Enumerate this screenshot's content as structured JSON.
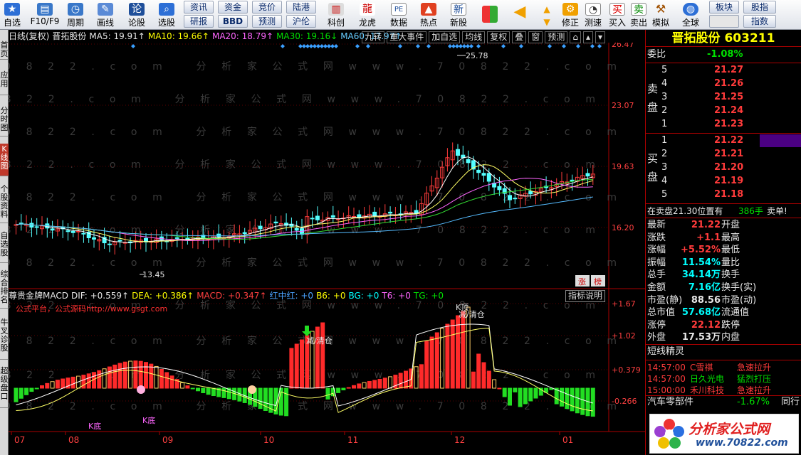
{
  "toolbar": {
    "buttons": [
      {
        "label": "自选"
      },
      {
        "label": "F10/F9"
      },
      {
        "label": "周期"
      },
      {
        "label": "画线"
      },
      {
        "label": "论股"
      },
      {
        "label": "选股"
      },
      {
        "label": "科创"
      },
      {
        "label": "龙虎"
      },
      {
        "label": "数据"
      },
      {
        "label": "热点"
      },
      {
        "label": "新股"
      },
      {
        "label": "修正"
      },
      {
        "label": "测速"
      },
      {
        "label": "买入"
      },
      {
        "label": "卖出"
      },
      {
        "label": "模拟"
      },
      {
        "label": "全球"
      }
    ],
    "pills": [
      "资讯",
      "资金",
      "竞价",
      "陆港",
      "研报",
      "BBD",
      "预测",
      "沪伦",
      "板块",
      "股指",
      "指数"
    ]
  },
  "left_tabs": [
    "首页",
    "应用",
    "分时图",
    "K线图",
    "个股资料",
    "自选股",
    "综合排名",
    "牛叉诊股",
    "超级盘口"
  ],
  "ma_bar": {
    "title": "日线(复权)",
    "name": "晋拓股份",
    "ma5": "MA5: 19.91↑",
    "ma10": "MA10: 19.66↑",
    "ma20": "MA20: 18.79↑",
    "ma30": "MA30: 19.16↓",
    "ma60": "MA60: 17.97↑",
    "tabs": [
      "九转",
      "重大事件",
      "加自选",
      "均线",
      "复权",
      "叠",
      "窗",
      "预测"
    ]
  },
  "price_axis": [
    "26.47",
    "23.07",
    "19.63",
    "16.20"
  ],
  "annotations": {
    "high": "25.78",
    "low": "13.45",
    "zhang": "涨",
    "bang": "榜"
  },
  "indicator": {
    "name": "尊贵金牌MACD",
    "dif": "DIF: +0.559↑",
    "dea": "DEA: +0.386↑",
    "macd": "MACD: +0.347↑",
    "hzh": "红中红: +0",
    "b6": "B6: +0",
    "bg": "BG: +0",
    "t6": "T6: +0",
    "tg": "TG: +0",
    "explain": "指标说明",
    "platform": "公式平台，公式源码http://www.gsgt.com",
    "jian1": "减/清仓",
    "jian2": "减/清仓",
    "kding": "K顶",
    "kdi1": "K底",
    "kdi2": "K底"
  },
  "indicator_axis": [
    "+1.67",
    "+1.02",
    "+0.379",
    "-0.266"
  ],
  "x_axis": [
    "07",
    "08",
    "09",
    "10",
    "11",
    "12",
    "01"
  ],
  "watermark": "0822.com 分析家公式网www.70822.com",
  "quote": {
    "title": "晋拓股份 603211",
    "weibi_label": "委比",
    "weibi": "-1.08%",
    "sell_label": [
      "卖",
      "盘"
    ],
    "buy_label": [
      "买",
      "盘"
    ],
    "asks": [
      {
        "n": "5",
        "p": "21.27"
      },
      {
        "n": "4",
        "p": "21.26"
      },
      {
        "n": "3",
        "p": "21.25"
      },
      {
        "n": "2",
        "p": "21.24"
      },
      {
        "n": "1",
        "p": "21.23"
      }
    ],
    "bids": [
      {
        "n": "1",
        "p": "21.22"
      },
      {
        "n": "2",
        "p": "21.21"
      },
      {
        "n": "3",
        "p": "21.20"
      },
      {
        "n": "4",
        "p": "21.19"
      },
      {
        "n": "5",
        "p": "21.18"
      }
    ],
    "alert_text": "在卖盘21.30位置有",
    "alert_vol": "386手",
    "alert_act": "卖单!",
    "stats": [
      {
        "l": "最新",
        "v": "21.22",
        "r": "开盘"
      },
      {
        "l": "涨跌",
        "v": "+1.1",
        "r": "最高"
      },
      {
        "l": "涨幅",
        "v": "+5.52%",
        "r": "最低"
      },
      {
        "l": "振幅",
        "v": "11.54%",
        "r": "量比"
      },
      {
        "l": "总手",
        "v": "34.14万",
        "r": "换手"
      },
      {
        "l": "金额",
        "v": "7.16亿",
        "r": "换手(实)"
      },
      {
        "l": "市盈(静)",
        "v": "88.56",
        "r": "市盈(动)"
      },
      {
        "l": "总市值",
        "v": "57.68亿",
        "r": "流通值"
      },
      {
        "l": "涨停",
        "v": "22.12",
        "r": "跌停"
      },
      {
        "l": "外盘",
        "v": "17.53万",
        "r": "内盘"
      }
    ],
    "elf_title": "短线精灵",
    "elf": [
      {
        "t": "14:57:00",
        "n": "C雪祺",
        "a": "急速拉升"
      },
      {
        "t": "14:57:00",
        "n": "日久光电",
        "a": "猛烈打压"
      },
      {
        "t": "15:00:00",
        "n": "禾川科技",
        "a": "急速拉升"
      }
    ],
    "sector": "汽车零部件",
    "sector_chg": "-1.67%",
    "sector_extra": "同行"
  },
  "logo_text": "分析家公式网",
  "logo_url": "www.70822.com",
  "chart_data": {
    "type": "candlestick",
    "price_axis_ticks": [
      26.47,
      23.07,
      19.63,
      16.2
    ],
    "indicator_axis_ticks": [
      1.67,
      1.02,
      0.379,
      -0.266
    ],
    "x_ticks": [
      "07",
      "08",
      "09",
      "10",
      "11",
      "12",
      "01"
    ],
    "high_label": 25.78,
    "low_label": 13.45
  }
}
